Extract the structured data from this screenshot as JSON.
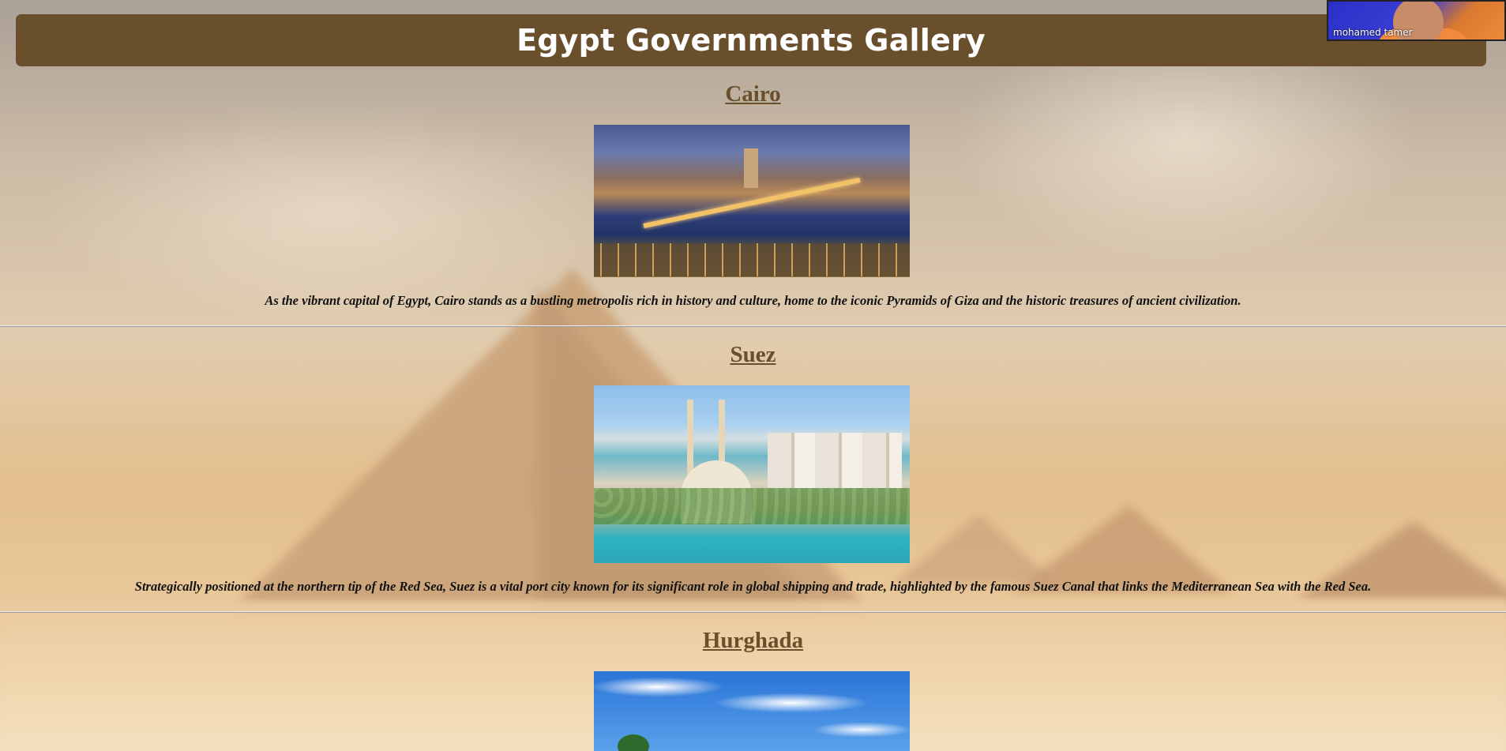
{
  "header": {
    "title": "Egypt Governments Gallery"
  },
  "video_overlay": {
    "participant_name": "mohamed tamer"
  },
  "sections": [
    {
      "name": "Cairo",
      "description": "As the vibrant capital of Egypt, Cairo stands as a bustling metropolis rich in history and culture, home to the iconic Pyramids of Giza and the historic treasures of ancient civilization."
    },
    {
      "name": "Suez",
      "description": "Strategically positioned at the northern tip of the Red Sea, Suez is a vital port city known for its significant role in global shipping and trade, highlighted by the famous Suez Canal that links the Mediterranean Sea with the Red Sea."
    },
    {
      "name": "Hurghada",
      "description": ""
    }
  ],
  "colors": {
    "header_bg": "#6a4f2d",
    "link": "#6a4f2d",
    "header_text": "#ffffff"
  }
}
